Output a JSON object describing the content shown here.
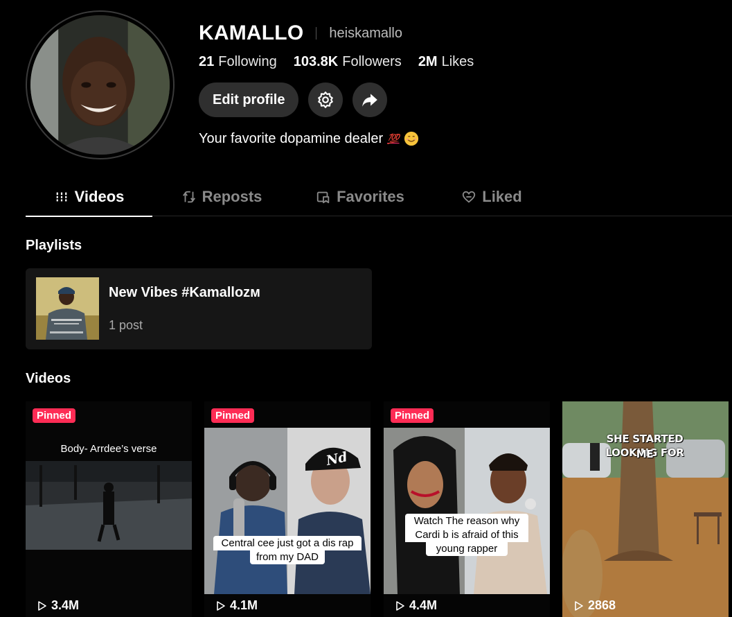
{
  "profile": {
    "display_name": "KAMALLO",
    "username": "heiskamallo",
    "stats": {
      "following_value": "21",
      "following_label": "Following",
      "followers_value": "103.8K",
      "followers_label": "Followers",
      "likes_value": "2M",
      "likes_label": "Likes"
    },
    "edit_button_label": "Edit profile",
    "bio_text": "Your favorite dopamine dealer",
    "bio_emoji_1": "💯",
    "icons": [
      "gear-icon",
      "share-arrow-icon"
    ]
  },
  "tabs": [
    {
      "label": "Videos",
      "icon": "grid-lines-icon",
      "active": true
    },
    {
      "label": "Reposts",
      "icon": "repost-icon",
      "active": false
    },
    {
      "label": "Favorites",
      "icon": "bookmark-icon",
      "active": false
    },
    {
      "label": "Liked",
      "icon": "heart-icon",
      "active": false
    }
  ],
  "playlists": {
    "title": "Playlists",
    "items": [
      {
        "title": "New Vibes #Kamallozᴍ",
        "count": "1 post"
      }
    ]
  },
  "videos": {
    "title": "Videos",
    "pinned_label": "Pinned",
    "items": [
      {
        "pinned": true,
        "caption": "Body- Arrdee’s verse",
        "views": "3.4M"
      },
      {
        "pinned": true,
        "caption_line1": "Central cee just got a dis rap",
        "caption_line2": "from my DAD",
        "cap_text": "Nd",
        "views": "4.1M"
      },
      {
        "pinned": true,
        "caption_line1": "Watch The reason why",
        "caption_line2": "Cardi b is afraid of this",
        "caption_line3": "young rapper",
        "views": "4.4M"
      },
      {
        "pinned": false,
        "caption_line1": "SHE STARTED LOOKING FOR",
        "caption_line2": "ME",
        "views": "2868"
      }
    ]
  },
  "colors": {
    "background": "#000000",
    "pinned_badge": "#fe2c55",
    "button_bg": "#2f2f2f",
    "inactive_tab": "#8a8a8a"
  }
}
